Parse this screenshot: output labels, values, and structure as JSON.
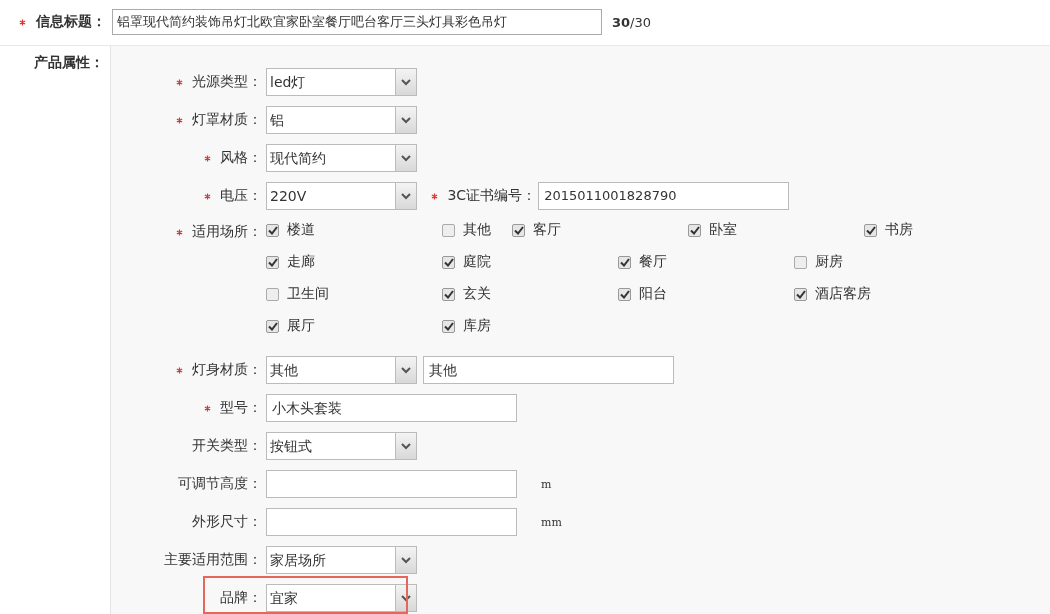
{
  "title_field": {
    "label": "信息标题：",
    "required": true,
    "value": "铝罩现代简约装饰吊灯北欧宜家卧室餐厅吧台客厅三头灯具彩色吊灯",
    "count": "30",
    "max": "/30"
  },
  "section_label": "产品属性：",
  "fields": [
    {
      "kind": "select",
      "label": "光源类型：",
      "required": true,
      "value": "led灯"
    },
    {
      "kind": "select",
      "label": "灯罩材质：",
      "required": true,
      "value": "铝"
    },
    {
      "kind": "select",
      "label": "风格：",
      "required": true,
      "value": "现代简约"
    },
    {
      "kind": "select",
      "label": "电压：",
      "required": true,
      "value": "220V",
      "extra_label": "3C证书编号：",
      "extra_required": true,
      "extra_value": "2015011001828790"
    },
    {
      "kind": "checks",
      "label": "适用场所：",
      "required": true,
      "rows": [
        [
          {
            "label": "楼道",
            "checked": true
          },
          {
            "label": "其他",
            "checked": false
          },
          {
            "label": "客厅",
            "checked": true
          },
          {
            "label": "卧室",
            "checked": true
          },
          {
            "label": "书房",
            "checked": true
          }
        ],
        [
          {
            "label": "走廊",
            "checked": true
          },
          {
            "label": "庭院",
            "checked": true
          },
          {
            "label": "餐厅",
            "checked": true
          },
          {
            "label": "厨房",
            "checked": false
          }
        ],
        [
          {
            "label": "卫生间",
            "checked": false
          },
          {
            "label": "玄关",
            "checked": true
          },
          {
            "label": "阳台",
            "checked": true
          },
          {
            "label": "酒店客房",
            "checked": true
          }
        ],
        [
          {
            "label": "展厅",
            "checked": true
          },
          {
            "label": "库房",
            "checked": true
          }
        ]
      ]
    },
    {
      "kind": "select",
      "label": "灯身材质：",
      "required": true,
      "value": "其他",
      "extra_value": "其他"
    },
    {
      "kind": "text",
      "label": "型号：",
      "required": true,
      "value": "小木头套装"
    },
    {
      "kind": "select",
      "label": "开关类型：",
      "required": false,
      "value": "按钮式"
    },
    {
      "kind": "text",
      "label": "可调节高度：",
      "required": false,
      "unit": "m"
    },
    {
      "kind": "text",
      "label": "外形尺寸：",
      "required": false,
      "unit": "mm"
    },
    {
      "kind": "select",
      "label": "主要适用范围：",
      "required": false,
      "value": "家居场所"
    },
    {
      "kind": "select",
      "label": "品牌：",
      "required": false,
      "value": "宜家",
      "highlighted": true
    }
  ]
}
